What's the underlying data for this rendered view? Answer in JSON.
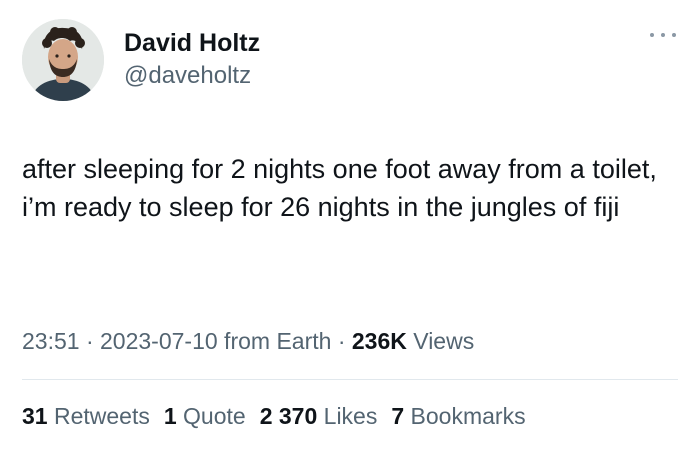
{
  "author": {
    "display_name": "David Holtz",
    "handle": "@daveholtz"
  },
  "tweet": {
    "text": "after sleeping for 2 nights one foot away from a toilet, i’m ready to sleep for 26 nights in the jungles of fiji"
  },
  "meta": {
    "time": "23:51",
    "separator": " · ",
    "date": "2023-07-10",
    "source": " from Earth",
    "views_count": "236K",
    "views_label": " Views"
  },
  "stats": {
    "retweets": {
      "count": "31",
      "label": " Retweets"
    },
    "quotes": {
      "count": "1",
      "label": " Quote"
    },
    "likes": {
      "count": "2 370",
      "label": " Likes"
    },
    "bookmarks": {
      "count": "7",
      "label": " Bookmarks"
    }
  },
  "icons": {
    "more": "more-options-icon"
  },
  "colors": {
    "text_primary": "#0f1419",
    "text_secondary": "#536471",
    "divider": "#e1e8ed",
    "background": "#ffffff"
  }
}
